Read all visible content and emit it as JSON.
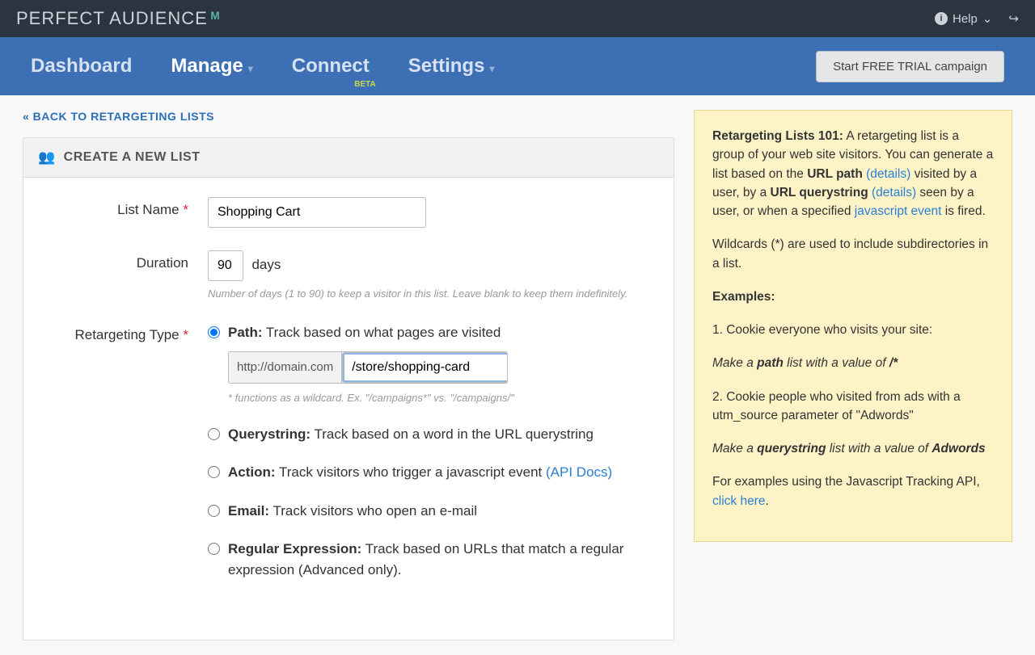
{
  "topbar": {
    "logo_text": "PERFECT AUDIENCE",
    "help": "Help"
  },
  "nav": {
    "dashboard": "Dashboard",
    "manage": "Manage",
    "connect": "Connect",
    "beta": "BETA",
    "settings": "Settings",
    "trial_button": "Start FREE TRIAL campaign"
  },
  "back_link": "« BACK TO RETARGETING LISTS",
  "panel_header": "CREATE A NEW LIST",
  "form": {
    "list_name_label": "List Name",
    "list_name_value": "Shopping Cart",
    "duration_label": "Duration",
    "duration_value": "90",
    "days": "days",
    "duration_hint": "Number of days (1 to 90) to keep a visitor in this list. Leave blank to keep them indefinitely.",
    "type_label": "Retargeting Type",
    "path_label": "Path:",
    "path_desc": " Track based on what pages are visited",
    "path_prefix": "http://domain.com",
    "path_value": "/store/shopping-card",
    "path_hint": "* functions as a wildcard. Ex. \"/campaigns*\" vs. \"/campaigns/\"",
    "query_label": "Querystring:",
    "query_desc": " Track based on a word in the URL querystring",
    "action_label": "Action:",
    "action_desc": " Track visitors who trigger a javascript event ",
    "action_api": "(API Docs)",
    "email_label": "Email:",
    "email_desc": " Track visitors who open an e-mail",
    "regex_label": "Regular Expression:",
    "regex_desc": " Track based on URLs that match a regular expression (Advanced only)."
  },
  "info": {
    "title": "Retargeting Lists 101:",
    "p1a": " A retargeting list is a group of your web site visitors. You can generate a list based on the ",
    "urlpath": "URL path",
    "details": "(details)",
    "p1b": " visited by a user, by a ",
    "urlquery": "URL querystring",
    "p1c": " seen by a user, or when a specified ",
    "jsevent": "javascript event",
    "p1d": " is fired.",
    "p2": "Wildcards (*) are used to include subdirectories in a list.",
    "examples": "Examples:",
    "ex1": "1. Cookie everyone who visits your site:",
    "ex1_make_a": "Make a ",
    "ex1_path": "path",
    "ex1_make_b": " list with a value of ",
    "ex1_val": "/*",
    "ex2": "2. Cookie people who visited from ads with a utm_source parameter of \"Adwords\"",
    "ex2_make_a": "Make a ",
    "ex2_qs": "querystring",
    "ex2_make_b": " list with a value of ",
    "ex2_val": "Adwords",
    "p3a": "For examples using the Javascript Tracking API, ",
    "clickhere": "click here",
    "p3b": "."
  }
}
